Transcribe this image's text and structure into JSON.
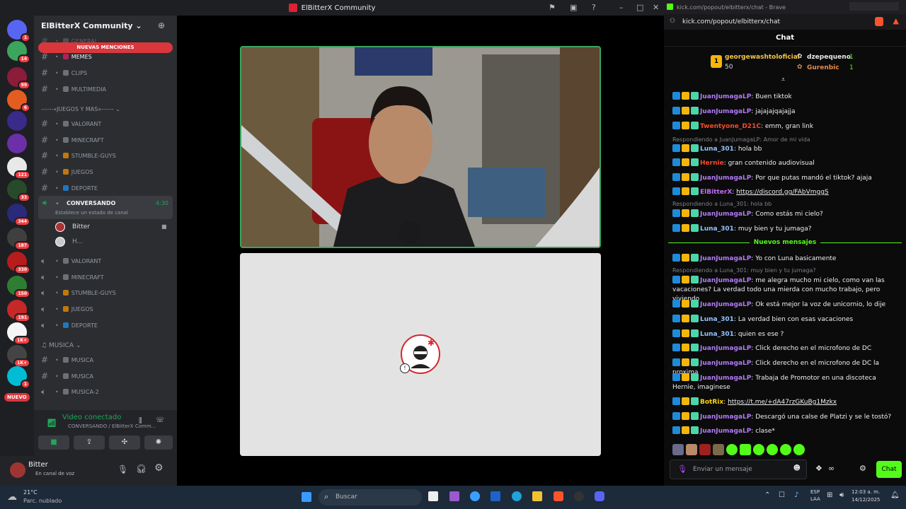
{
  "discord": {
    "window_title": "ElBitterX Community",
    "server_name": "ElBitterX Community",
    "mentions_banner": "NUEVAS MENCIONES",
    "channels_top": [
      {
        "name": "GENERAL"
      },
      {
        "name": "MEMES"
      },
      {
        "name": "CLIPS"
      },
      {
        "name": "MULTIMEDIA"
      }
    ],
    "category_games": "------«JUEGOS Y MAS»------",
    "channels_games": [
      {
        "name": "VALORANT"
      },
      {
        "name": "MINECRAFT"
      },
      {
        "name": "STUMBLE-GUYS"
      },
      {
        "name": "JUEGOS"
      },
      {
        "name": "DEPORTE"
      }
    ],
    "voice_active": {
      "name": "CONVERSANDO",
      "time": "4:30",
      "status": "Establece un estado de canal"
    },
    "voice_users": [
      "Bitter",
      "H..."
    ],
    "voice_channels": [
      "VALORANT",
      "MINECRAFT",
      "STUMBLE-GUYS",
      "JUEGOS",
      "DEPORTE"
    ],
    "category_music": "MUSICA",
    "music_channels": [
      "MUSICA",
      "MUSICA",
      "MUSICA-2"
    ],
    "new_label": "NUEVO",
    "server_badges": [
      "1",
      "14",
      "99",
      "6",
      "121",
      "33",
      "344",
      "187",
      "330",
      "150",
      "191",
      "1K+",
      "1K+",
      "1"
    ],
    "connection": {
      "title": "Video conectado",
      "sub": "CONVERSANDO / ElBitterX Comm..."
    },
    "user": {
      "name": "Bitter",
      "status": "En canal de voz"
    }
  },
  "browser": {
    "title": "kick.com/popout/elbitterx/chat - Brave",
    "url": "kick.com/popout/elbitterx/chat",
    "header": "Chat",
    "top": [
      {
        "rank": "1",
        "name": "georgewashtoloficial",
        "amount": "50"
      },
      {
        "rank": "2",
        "name": "dzepequeno",
        "amount": "1"
      },
      {
        "rank": "3",
        "name": "Gurenbic",
        "amount": "1"
      }
    ],
    "new_messages_label": "Nuevos mensajes",
    "input_placeholder": "Enviar un mensaje",
    "chat_button": "Chat",
    "messages": [
      {
        "user": "JuanJumagaLP",
        "color": "#b17cf5",
        "text": ": Buen tiktok"
      },
      {
        "user": "JuanJumagaLP",
        "color": "#b17cf5",
        "text": ": jajajajqajajja"
      },
      {
        "user": "Twentyone_D21C",
        "color": "#f04d2c",
        "text": ": emm, gran link"
      },
      {
        "reply": "Respondiendo a JuanJumagaLP: Amor de mi vida"
      },
      {
        "user": "Luna_301",
        "color": "#93c4ff",
        "text": ": hola bb"
      },
      {
        "user": "Hernie",
        "color": "#f04d2c",
        "text": ": gran contenido audiovisual"
      },
      {
        "user": "JuanJumagaLP",
        "color": "#b17cf5",
        "text": ": Por que putas mandó el tiktok? ajaja"
      },
      {
        "user": "ElBitterX",
        "color": "#c46cf5",
        "text": ": ",
        "link": "https://discord.gg/FAbVmggS"
      },
      {
        "reply": "Respondiendo a Luna_301: hola bb"
      },
      {
        "user": "JuanJumagaLP",
        "color": "#b17cf5",
        "text": ": Como estás mi cielo?"
      },
      {
        "user": "Luna_301",
        "color": "#93c4ff",
        "text": ": muy bien y tu jumaga?"
      },
      {
        "user": "JuanJumagaLP",
        "color": "#b17cf5",
        "text": ": Yo con Luna basicamente"
      },
      {
        "reply": "Respondiendo a Luna_301: muy bien y tu jumaga?"
      },
      {
        "user": "JuanJumagaLP",
        "color": "#b17cf5",
        "text": ": me alegra mucho mi cielo, como van las vacaciones? La verdad todo una mierda con mucho trabajo, pero viviendo"
      },
      {
        "user": "JuanJumagaLP",
        "color": "#b17cf5",
        "text": ": Ok está mejor la voz de unicornio, lo dije"
      },
      {
        "user": "Luna_301",
        "color": "#93c4ff",
        "text": ": La verdad bien con esas vacaciones"
      },
      {
        "user": "Luna_301",
        "color": "#93c4ff",
        "text": ": quien es ese ?"
      },
      {
        "user": "JuanJumagaLP",
        "color": "#b17cf5",
        "text": ": Click derecho en el microfono de DC"
      },
      {
        "user": "JuanJumagaLP",
        "color": "#b17cf5",
        "text": ": Click derecho en el microfono de DC la proxima"
      },
      {
        "user": "JuanJumagaLP",
        "color": "#b17cf5",
        "text": ": Trabaja de Promotor en una discoteca Hernie, imaginese"
      },
      {
        "user": "BotRix",
        "color": "#ffd500",
        "text": ": ",
        "link": "https://t.me/+dA47rzGKuBg1Mzkx"
      },
      {
        "user": "JuanJumagaLP",
        "color": "#b17cf5",
        "text": ": Descargó una calse de Platzi y se le tostó?"
      },
      {
        "user": "JuanJumagaLP",
        "color": "#b17cf5",
        "text": ": clase*"
      }
    ]
  },
  "taskbar": {
    "weather_temp": "21°C",
    "weather_desc": "Parc. nublado",
    "search": "Buscar",
    "lang1": "ESP",
    "lang2": "LAA",
    "time": "12:03 a. m.",
    "date": "14/12/2025"
  }
}
